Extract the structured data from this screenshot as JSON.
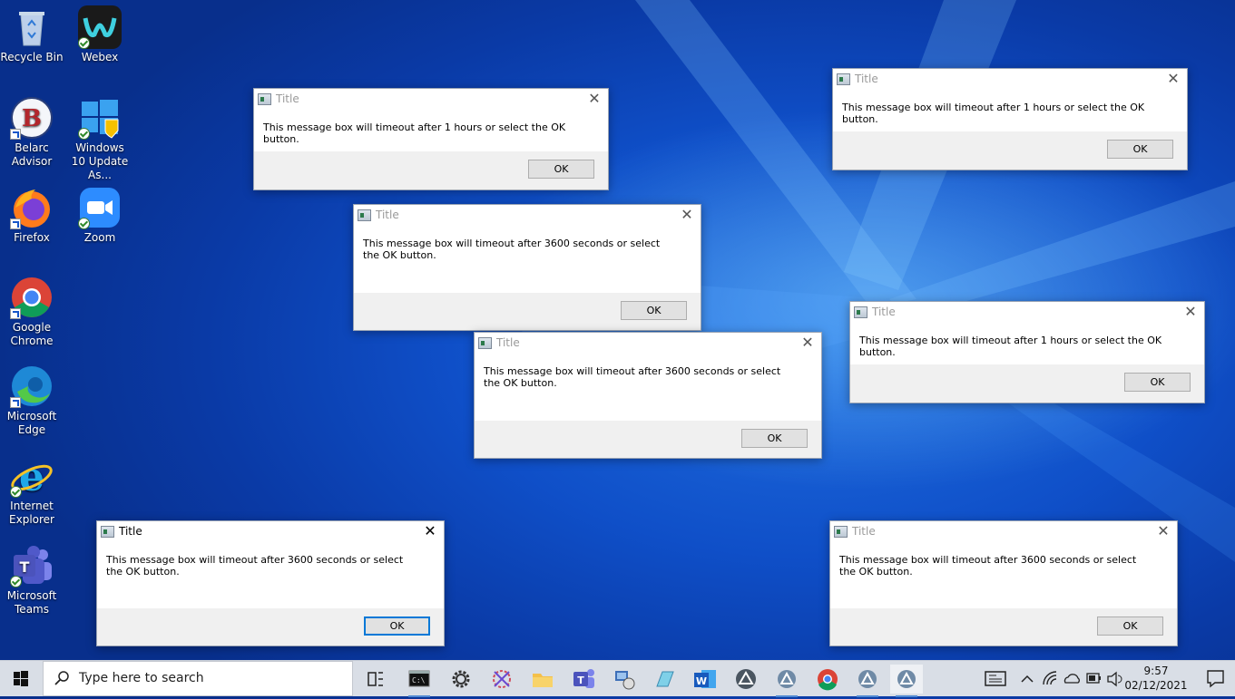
{
  "desktop": {
    "icons": [
      {
        "label": "Recycle Bin"
      },
      {
        "label": "Webex"
      },
      {
        "label": "Belarc Advisor"
      },
      {
        "label": "Windows 10 Update As..."
      },
      {
        "label": "Firefox"
      },
      {
        "label": "Zoom"
      },
      {
        "label": "Google Chrome"
      },
      {
        "label": "Microsoft Edge"
      },
      {
        "label": "Internet Explorer"
      },
      {
        "label": "Microsoft Teams"
      }
    ]
  },
  "dialogs": [
    {
      "title": "Title",
      "message": "This message box will timeout after 1 hours or select the OK button.",
      "ok": "OK"
    },
    {
      "title": "Title",
      "message": "This message box will timeout after 1 hours or select the OK button.",
      "ok": "OK"
    },
    {
      "title": "Title",
      "message": "This message box will timeout after 3600 seconds or select the OK button.",
      "ok": "OK"
    },
    {
      "title": "Title",
      "message": "This message box will timeout after 1 hours or select the OK button.",
      "ok": "OK"
    },
    {
      "title": "Title",
      "message": "This message box will timeout after 3600 seconds or select the OK button.",
      "ok": "OK"
    },
    {
      "title": "Title",
      "message": "This message box will timeout after 3600 seconds or select the OK button.",
      "ok": "OK"
    },
    {
      "title": "Title",
      "message": "This message box will timeout after 3600 seconds or select the OK button.",
      "ok": "OK"
    }
  ],
  "taskbar": {
    "search_placeholder": "Type here to search",
    "apps": [
      "task-view",
      "command-prompt",
      "settings",
      "snipping-tool",
      "file-explorer",
      "teams",
      "network-tool",
      "notepad",
      "word",
      "app-triangle",
      "app-triangle",
      "chrome",
      "app-triangle",
      "app-triangle"
    ],
    "clock": {
      "time": "9:57",
      "date": "02/12/2021"
    }
  },
  "colors": {
    "accent": "#0078d7",
    "desktop": "#0f4fc8",
    "taskbar": "#d9dee6"
  }
}
